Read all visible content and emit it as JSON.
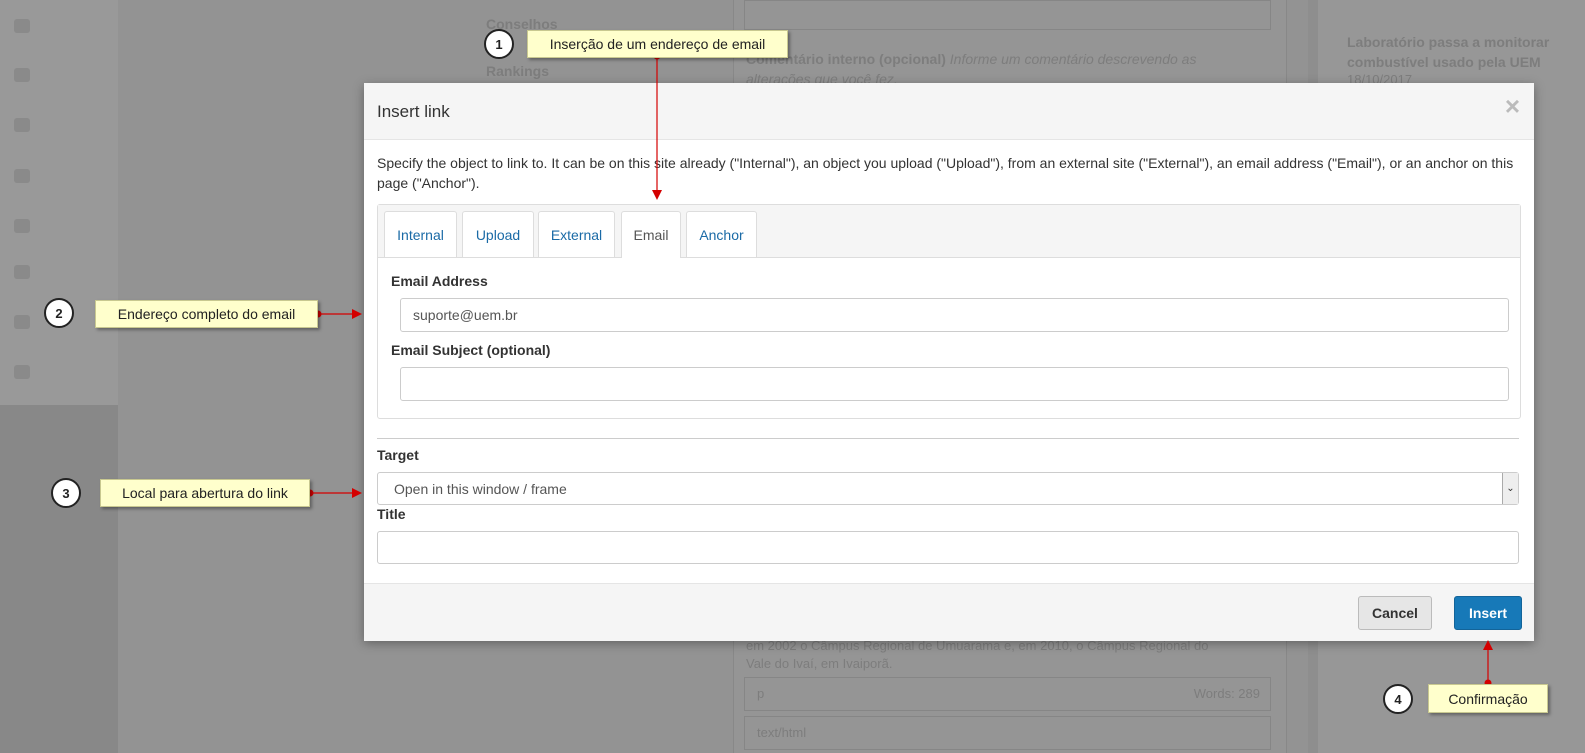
{
  "background": {
    "sidebar_items": [
      "",
      "",
      "",
      "",
      "",
      "",
      "",
      ""
    ],
    "center_links": [
      "Conselhos",
      "Rankings"
    ],
    "comment_label": "Comentário interno (opcional)",
    "comment_hint": "Informe um comentário descrevendo as alterações que você fez.",
    "news_title": "Laboratório passa a monitorar combustível usado pela UEM",
    "news_date": "18/10/2017",
    "body_text_1": "em 2002 o Câmpus Regional de Umuarama e, em 2010, o Câmpus Regional do",
    "body_text_2": "Vale do Ivaí, em Ivaiporã.",
    "path_label": "p",
    "word_count": "Words: 289",
    "format_select": "text/html"
  },
  "modal": {
    "title": "Insert link",
    "close_glyph": "×",
    "description": "Specify the object to link to. It can be on this site already (\"Internal\"), an object you upload (\"Upload\"), from an external site (\"External\"), an email address (\"Email\"), or an anchor on this page (\"Anchor\").",
    "tabs": [
      "Internal",
      "Upload",
      "External",
      "Email",
      "Anchor"
    ],
    "active_tab": "Email",
    "email_address_label": "Email Address",
    "email_address_value": "suporte@uem.br",
    "email_subject_label": "Email Subject (optional)",
    "email_subject_value": "",
    "target_label": "Target",
    "target_value": "Open in this window / frame",
    "title_label": "Title",
    "title_value": "",
    "cancel_label": "Cancel",
    "insert_label": "Insert"
  },
  "callouts": [
    {
      "number": "1",
      "text": "Inserção de um endereço de email"
    },
    {
      "number": "2",
      "text": "Endereço completo do email"
    },
    {
      "number": "3",
      "text": "Local para abertura do link"
    },
    {
      "number": "4",
      "text": "Confirmação"
    }
  ],
  "colors": {
    "overlay_gray": "#8e8e8e",
    "link_blue": "#1a6aa6",
    "insert_blue": "#1779b8",
    "callout_yellow": "#ffffcc",
    "arrow_red": "#d40000"
  }
}
